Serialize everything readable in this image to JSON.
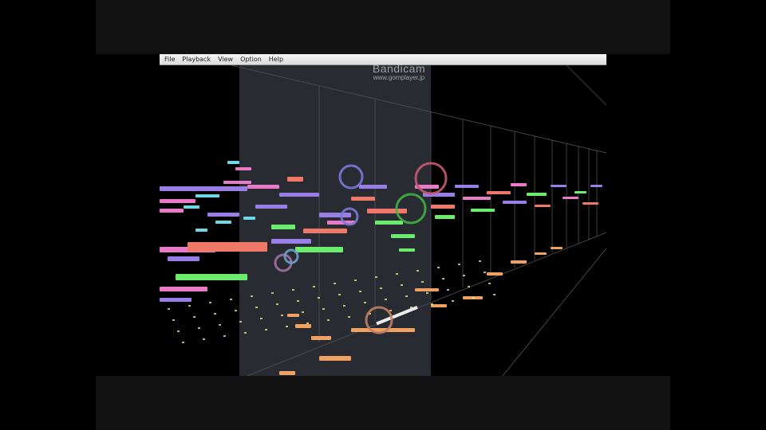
{
  "menu": {
    "items": [
      "File",
      "Playback",
      "View",
      "Option",
      "Help"
    ]
  },
  "watermark": {
    "title": "Bandicam",
    "url": "www.gomplayer.jp"
  },
  "colors": {
    "letterbox": "#111111",
    "background": "#000000",
    "playhead_band": "#4a4f5c",
    "purple": "#9a7ee8",
    "pink": "#e87ac8",
    "salmon": "#f07868",
    "green": "#6cec6c",
    "cyan": "#6cd8e8",
    "orange": "#f0a060",
    "yellow": "#e8e870"
  },
  "icons": {
    "note_ring": "ring-icon"
  }
}
